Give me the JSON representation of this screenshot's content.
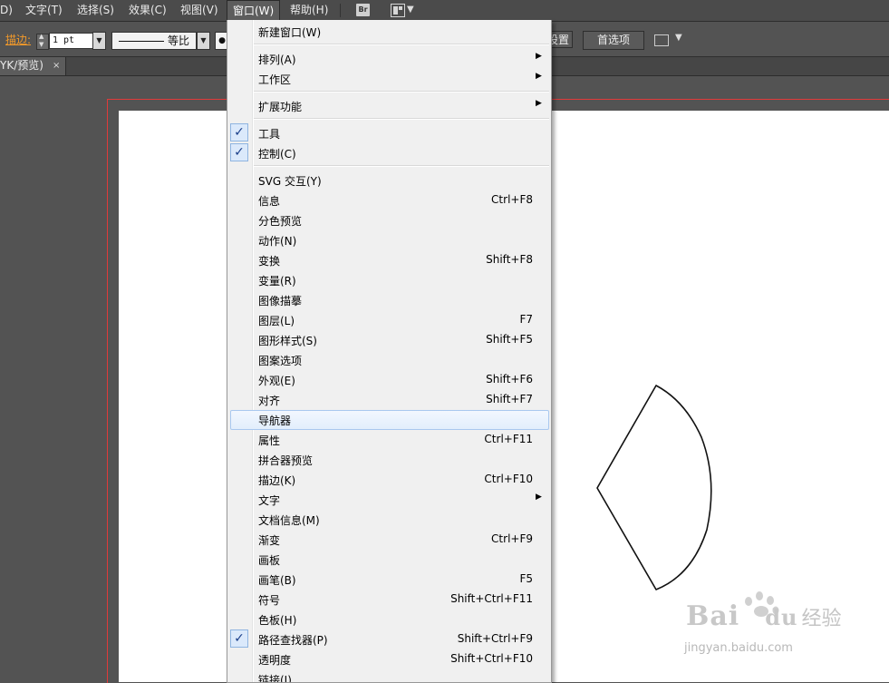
{
  "menubar": {
    "items": [
      "D)",
      "文字(T)",
      "选择(S)",
      "效果(C)",
      "视图(V)",
      "窗口(W)",
      "帮助(H)"
    ],
    "active": "窗口(W)",
    "bridge_label": "Br"
  },
  "control": {
    "stroke_label": "描边:",
    "stroke_value": "1 pt",
    "profile_label": "等比",
    "bullet": "●",
    "doc_setup_label": "设置",
    "preferences_label": "首选项"
  },
  "tab": {
    "title": "YK/预览)",
    "close": "×"
  },
  "window_menu": {
    "items": [
      {
        "label": "新建窗口(W)",
        "shortcut": "",
        "submenu": false,
        "checked": false
      },
      {
        "label": "排列(A)",
        "shortcut": "",
        "submenu": true,
        "checked": false
      },
      {
        "label": "工作区",
        "shortcut": "",
        "submenu": true,
        "checked": false
      },
      {
        "label": "扩展功能",
        "shortcut": "",
        "submenu": true,
        "checked": false
      },
      {
        "label": "工具",
        "shortcut": "",
        "submenu": false,
        "checked": true
      },
      {
        "label": "控制(C)",
        "shortcut": "",
        "submenu": false,
        "checked": true
      },
      {
        "label": "SVG 交互(Y)",
        "shortcut": "",
        "submenu": false,
        "checked": false
      },
      {
        "label": "信息",
        "shortcut": "Ctrl+F8",
        "submenu": false,
        "checked": false
      },
      {
        "label": "分色预览",
        "shortcut": "",
        "submenu": false,
        "checked": false
      },
      {
        "label": "动作(N)",
        "shortcut": "",
        "submenu": false,
        "checked": false
      },
      {
        "label": "变换",
        "shortcut": "Shift+F8",
        "submenu": false,
        "checked": false
      },
      {
        "label": "变量(R)",
        "shortcut": "",
        "submenu": false,
        "checked": false
      },
      {
        "label": "图像描摹",
        "shortcut": "",
        "submenu": false,
        "checked": false
      },
      {
        "label": "图层(L)",
        "shortcut": "F7",
        "submenu": false,
        "checked": false
      },
      {
        "label": "图形样式(S)",
        "shortcut": "Shift+F5",
        "submenu": false,
        "checked": false
      },
      {
        "label": "图案选项",
        "shortcut": "",
        "submenu": false,
        "checked": false
      },
      {
        "label": "外观(E)",
        "shortcut": "Shift+F6",
        "submenu": false,
        "checked": false
      },
      {
        "label": "对齐",
        "shortcut": "Shift+F7",
        "submenu": false,
        "checked": false
      },
      {
        "label": "导航器",
        "shortcut": "",
        "submenu": false,
        "checked": false,
        "highlighted": true
      },
      {
        "label": "属性",
        "shortcut": "Ctrl+F11",
        "submenu": false,
        "checked": false
      },
      {
        "label": "拼合器预览",
        "shortcut": "",
        "submenu": false,
        "checked": false
      },
      {
        "label": "描边(K)",
        "shortcut": "Ctrl+F10",
        "submenu": false,
        "checked": false
      },
      {
        "label": "文字",
        "shortcut": "",
        "submenu": true,
        "checked": false
      },
      {
        "label": "文档信息(M)",
        "shortcut": "",
        "submenu": false,
        "checked": false
      },
      {
        "label": "渐变",
        "shortcut": "Ctrl+F9",
        "submenu": false,
        "checked": false
      },
      {
        "label": "画板",
        "shortcut": "",
        "submenu": false,
        "checked": false
      },
      {
        "label": "画笔(B)",
        "shortcut": "F5",
        "submenu": false,
        "checked": false
      },
      {
        "label": "符号",
        "shortcut": "Shift+Ctrl+F11",
        "submenu": false,
        "checked": false
      },
      {
        "label": "色板(H)",
        "shortcut": "",
        "submenu": false,
        "checked": false
      },
      {
        "label": "路径查找器(P)",
        "shortcut": "Shift+Ctrl+F9",
        "submenu": false,
        "checked": true
      },
      {
        "label": "透明度",
        "shortcut": "Shift+Ctrl+F10",
        "submenu": false,
        "checked": false
      },
      {
        "label": "链接(I)",
        "shortcut": "",
        "submenu": false,
        "checked": false
      }
    ]
  },
  "watermark": {
    "logo": "Bai",
    "logo2": "du",
    "cn": "经验",
    "url": "jingyan.baidu.com"
  },
  "colors": {
    "accent_stroke_label": "#f39a2a",
    "bleed_line": "#e03a3a",
    "highlight": "#dbe9fb"
  }
}
